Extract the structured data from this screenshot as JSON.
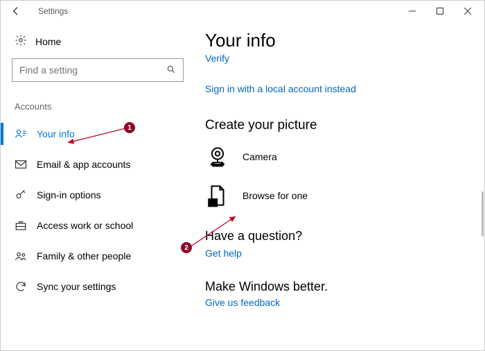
{
  "window": {
    "title": "Settings"
  },
  "sidebar": {
    "home": "Home",
    "search_placeholder": "Find a setting",
    "section": "Accounts",
    "items": [
      {
        "label": "Your info"
      },
      {
        "label": "Email & app accounts"
      },
      {
        "label": "Sign-in options"
      },
      {
        "label": "Access work or school"
      },
      {
        "label": "Family & other people"
      },
      {
        "label": "Sync your settings"
      }
    ]
  },
  "content": {
    "title": "Your info",
    "cutoff_link": "Verify",
    "local_account_link": "Sign in with a local account instead",
    "create_picture_heading": "Create your picture",
    "camera_label": "Camera",
    "browse_label": "Browse for one",
    "question_heading": "Have a question?",
    "get_help_link": "Get help",
    "better_heading": "Make Windows better.",
    "feedback_link": "Give us feedback"
  },
  "annotations": {
    "badge1": "1",
    "badge2": "2"
  }
}
